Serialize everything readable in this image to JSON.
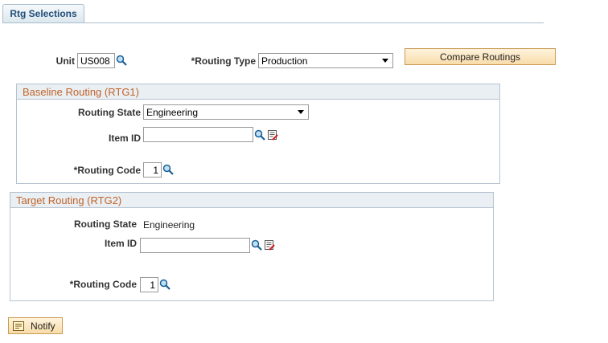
{
  "tab": {
    "label": "Rtg Selections"
  },
  "top": {
    "unit_label": "Unit",
    "unit_value": "US008",
    "routing_type_label": "*Routing Type",
    "routing_type_value": "Production",
    "compare_button": "Compare Routings"
  },
  "baseline": {
    "title": "Baseline Routing (RTG1)",
    "routing_state_label": "Routing State",
    "routing_state_value": "Engineering",
    "item_id_label": "Item ID",
    "item_id_value": "",
    "routing_code_label": "*Routing Code",
    "routing_code_value": "1"
  },
  "target": {
    "title": "Target Routing (RTG2)",
    "routing_state_label": "Routing State",
    "routing_state_value": "Engineering",
    "item_id_label": "Item ID",
    "item_id_value": "",
    "routing_code_label": "*Routing Code",
    "routing_code_value": "1"
  },
  "notify_button": "Notify",
  "icons": {
    "lookup": "magnifier-icon",
    "detail": "item-detail-icon",
    "notify": "notify-icon"
  },
  "colors": {
    "group_title": "#c0632a",
    "button_bg": "#f8dcaa",
    "tab_text": "#1f4e79"
  }
}
